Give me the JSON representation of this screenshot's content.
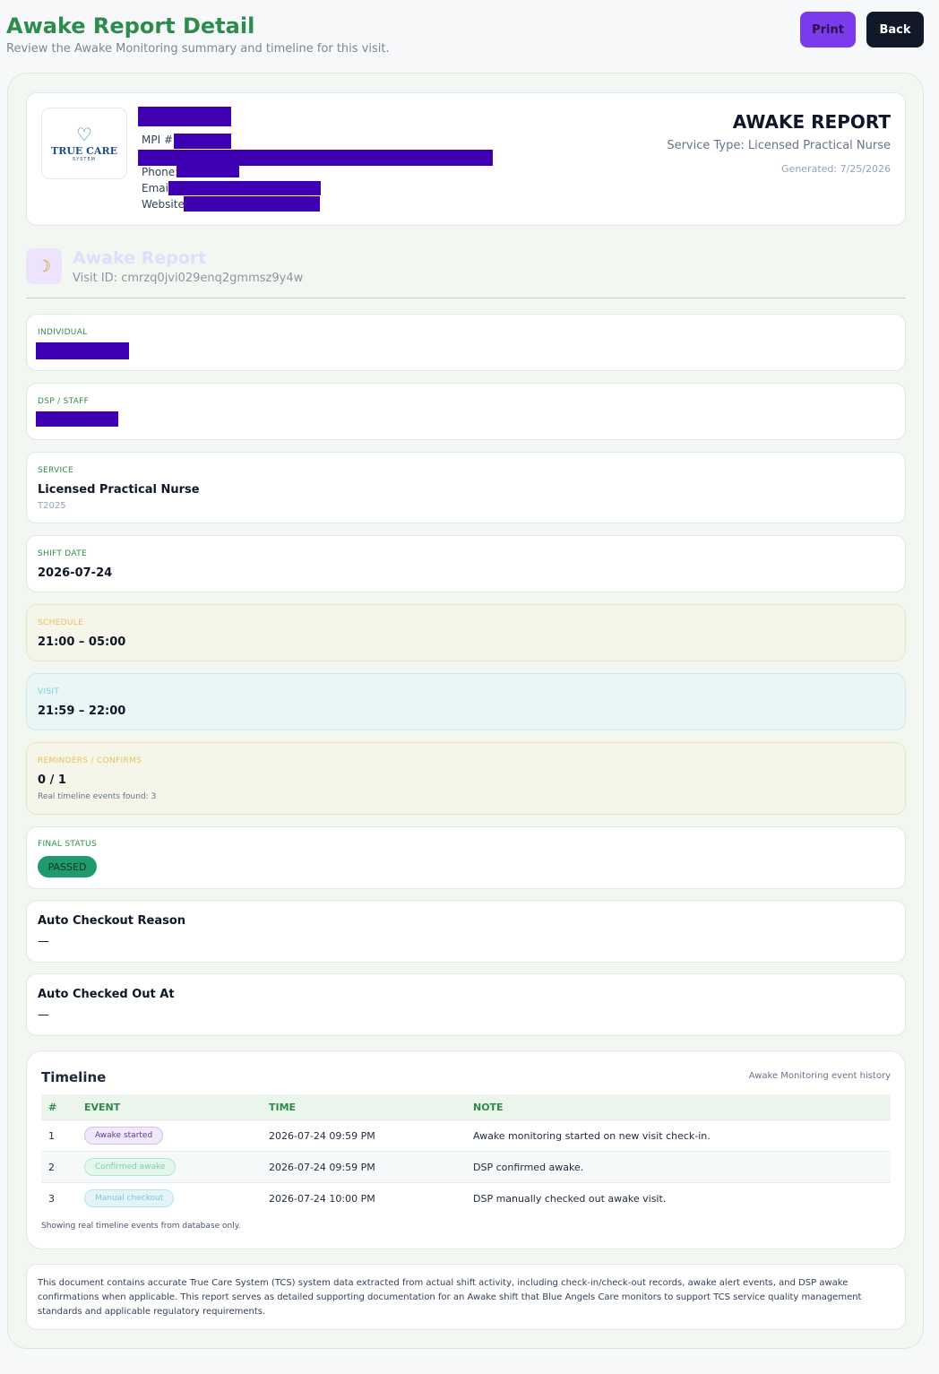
{
  "header": {
    "title": "Awake Report Detail",
    "subtitle": "Review the Awake Monitoring summary and timeline for this visit.",
    "print_label": "Print",
    "back_label": "Back"
  },
  "agency": {
    "logo_text": "TRUE CARE",
    "logo_subtext": "SYSTEM",
    "mpi_label": "MPI #:",
    "phone_label": "Phone:",
    "email_label": "Email:",
    "website_label": "Website:"
  },
  "report": {
    "title": "AWAKE REPORT",
    "service_type": "Service Type: Licensed Practical Nurse",
    "generated": "Generated: 7/25/2026",
    "section_title": "Awake Report",
    "visit_id": "Visit ID: cmrzq0jvi029enq2gmmsz9y4w"
  },
  "fields": {
    "individual_label": "INDIVIDUAL",
    "staff_label": "DSP / STAFF",
    "service_label": "SERVICE",
    "service_value": "Licensed Practical Nurse",
    "service_code": "T2025",
    "shift_date_label": "SHIFT DATE",
    "shift_date_value": "2026-07-24",
    "schedule_label": "SCHEDULE",
    "schedule_value": "21:00 – 05:00",
    "visit_label": "VISIT",
    "visit_value": "21:59 – 22:00",
    "reminders_label": "REMINDERS / CONFIRMS",
    "reminders_value": "0 / 1",
    "reminders_note": "Real timeline events found: 3",
    "final_status_label": "FINAL STATUS",
    "final_status_value": "PASSED",
    "auto_checkout_reason_label": "Auto Checkout Reason",
    "auto_checkout_reason_value": "—",
    "auto_checked_out_at_label": "Auto Checked Out At",
    "auto_checked_out_at_value": "—"
  },
  "timeline": {
    "title": "Timeline",
    "subtitle": "Awake Monitoring event history",
    "columns": [
      "#",
      "EVENT",
      "TIME",
      "NOTE"
    ],
    "rows": [
      {
        "num": "1",
        "event": "Awake started",
        "time": "2026-07-24 09:59 PM",
        "note": "Awake monitoring started on new visit check-in."
      },
      {
        "num": "2",
        "event": "Confirmed awake",
        "time": "2026-07-24 09:59 PM",
        "note": "DSP confirmed awake."
      },
      {
        "num": "3",
        "event": "Manual checkout",
        "time": "2026-07-24 10:00 PM",
        "note": "DSP manually checked out awake visit."
      }
    ],
    "footnote": "Showing real timeline events from database only."
  },
  "disclaimer": "This document contains accurate True Care System (TCS) system data extracted from actual shift activity, including check-in/check-out records, awake alert events, and DSP awake confirmations when applicable. This report serves as detailed supporting documentation for an Awake shift that Blue Angels Care monitors to support TCS service quality management standards and applicable regulatory requirements.",
  "colors": {
    "title_green": "#2e8b4e",
    "print_purple": "#7c3aed",
    "back_dark": "#111827",
    "redaction": "#3f00b4",
    "passed_green": "#1f9a6d"
  },
  "icons": {
    "section_icon": "moon-icon",
    "logo_icon": "heart-family-icon"
  }
}
